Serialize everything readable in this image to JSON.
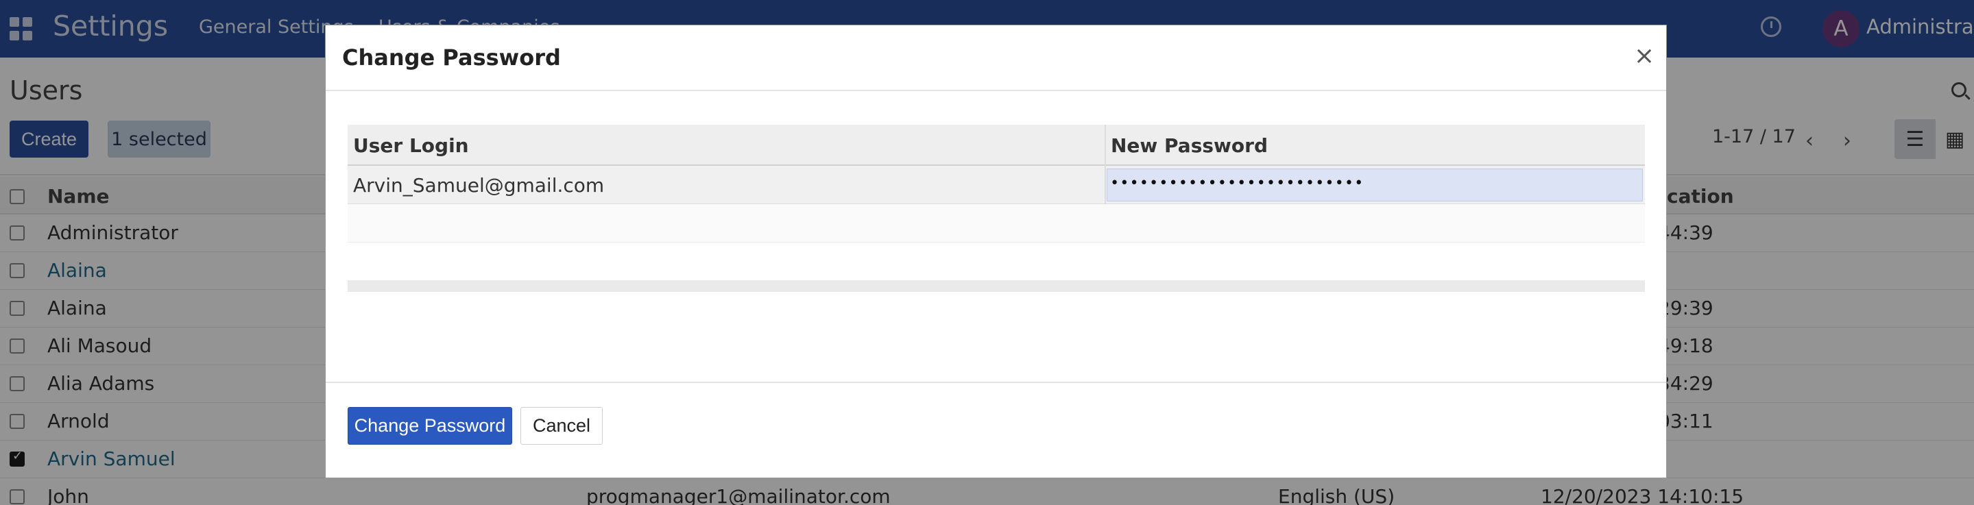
{
  "navbar": {
    "app_title": "Settings",
    "menu_general": "General Settings",
    "menu_users": "Users & Companies",
    "user_initial": "A",
    "user_name": "Administrator",
    "icons": [
      "apps-icon",
      "clock-icon"
    ]
  },
  "control": {
    "page_title": "Users",
    "create_label": "Create",
    "selected_label": "1 selected",
    "pager": "1-17 / 17",
    "prev_icon": "‹",
    "next_icon": "›",
    "view_list_icon": "☰",
    "view_kanban_icon": "▦"
  },
  "users_table": {
    "columns": {
      "name": "Name",
      "auth": "tication"
    },
    "rows": [
      {
        "name": "Administrator",
        "time": "44:39",
        "link": false,
        "checked": false
      },
      {
        "name": "Alaina",
        "time": "",
        "link": true,
        "checked": false
      },
      {
        "name": "Alaina",
        "time": "29:39",
        "link": false,
        "checked": false
      },
      {
        "name": "Ali Masoud",
        "time": "49:18",
        "link": false,
        "checked": false
      },
      {
        "name": "Alia Adams",
        "time": "34:29",
        "link": false,
        "checked": false
      },
      {
        "name": "Arnold",
        "time": "03:11",
        "link": false,
        "checked": false
      },
      {
        "name": "Arvin Samuel",
        "time": "",
        "link": true,
        "checked": true
      },
      {
        "name": "John",
        "email": "progmanager1@mailinator.com",
        "lang": "English (US)",
        "date": "12/20/2023 14:10:15",
        "link": false,
        "checked": false
      }
    ]
  },
  "modal": {
    "title": "Change Password",
    "close_icon": "×",
    "col_login": "User Login",
    "col_new_password": "New Password",
    "row_login": "Arvin_Samuel@gmail.com",
    "row_password_value": "••••••••••••••••••••••••••",
    "change_button": "Change Password",
    "cancel_button": "Cancel"
  }
}
